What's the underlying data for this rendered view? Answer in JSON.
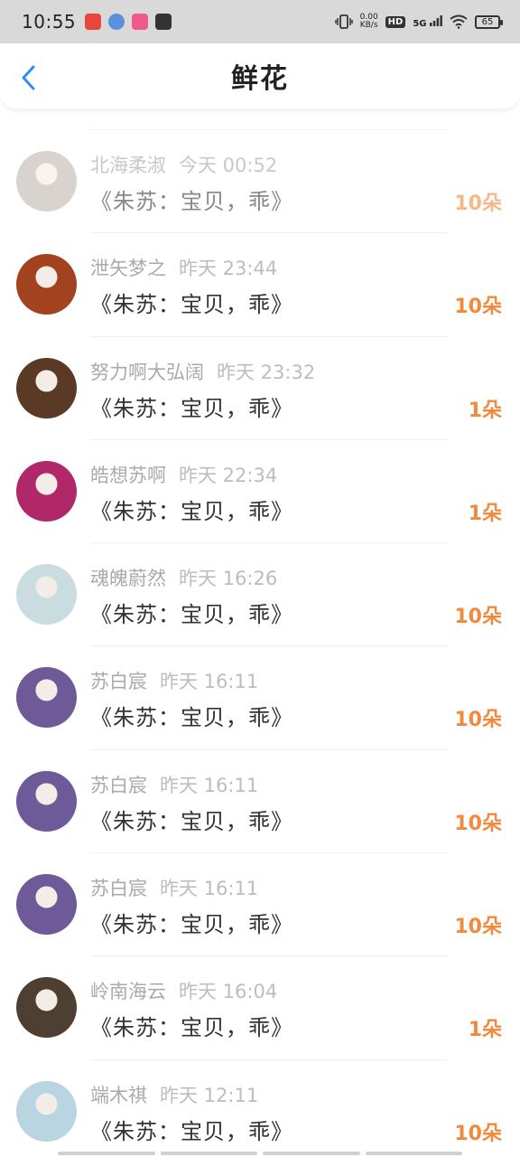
{
  "status_bar": {
    "time": "10:55",
    "net_speed_value": "0.00",
    "net_speed_unit": "KB/s",
    "hd_label": "HD",
    "signal_label": "5G",
    "battery": "65"
  },
  "header": {
    "title": "鲜花",
    "back_icon": "chevron-left-icon",
    "accent_color": "#2f8cff"
  },
  "colors": {
    "count": "#f08a3e",
    "meta": "#aaaaaa"
  },
  "records": [
    {
      "user": "北海柔淑",
      "time": "今天 00:52",
      "gift": "《朱苏：宝贝，乖》",
      "count": "10朵",
      "avatar": "#bdb6ae"
    },
    {
      "user": "泄矢梦之",
      "time": "昨天 23:44",
      "gift": "《朱苏：宝贝，乖》",
      "count": "10朵",
      "avatar": "#a2421f"
    },
    {
      "user": "努力啊大弘阔",
      "time": "昨天 23:32",
      "gift": "《朱苏：宝贝，乖》",
      "count": "1朵",
      "avatar": "#5a3a25"
    },
    {
      "user": "皓想苏啊",
      "time": "昨天 22:34",
      "gift": "《朱苏：宝贝，乖》",
      "count": "1朵",
      "avatar": "#b0286a"
    },
    {
      "user": "魂魄蔚然",
      "time": "昨天 16:26",
      "gift": "《朱苏：宝贝，乖》",
      "count": "10朵",
      "avatar": "#c9dce0"
    },
    {
      "user": "苏白宸",
      "time": "昨天 16:11",
      "gift": "《朱苏：宝贝，乖》",
      "count": "10朵",
      "avatar": "#6e5a98"
    },
    {
      "user": "苏白宸",
      "time": "昨天 16:11",
      "gift": "《朱苏：宝贝，乖》",
      "count": "10朵",
      "avatar": "#6e5a98"
    },
    {
      "user": "苏白宸",
      "time": "昨天 16:11",
      "gift": "《朱苏：宝贝，乖》",
      "count": "10朵",
      "avatar": "#6e5a98"
    },
    {
      "user": "岭南海云",
      "time": "昨天 16:04",
      "gift": "《朱苏：宝贝，乖》",
      "count": "1朵",
      "avatar": "#4e3f33"
    },
    {
      "user": "端木祺",
      "time": "昨天 12:11",
      "gift": "《朱苏：宝贝，乖》",
      "count": "10朵",
      "avatar": "#b9d5e2"
    }
  ]
}
